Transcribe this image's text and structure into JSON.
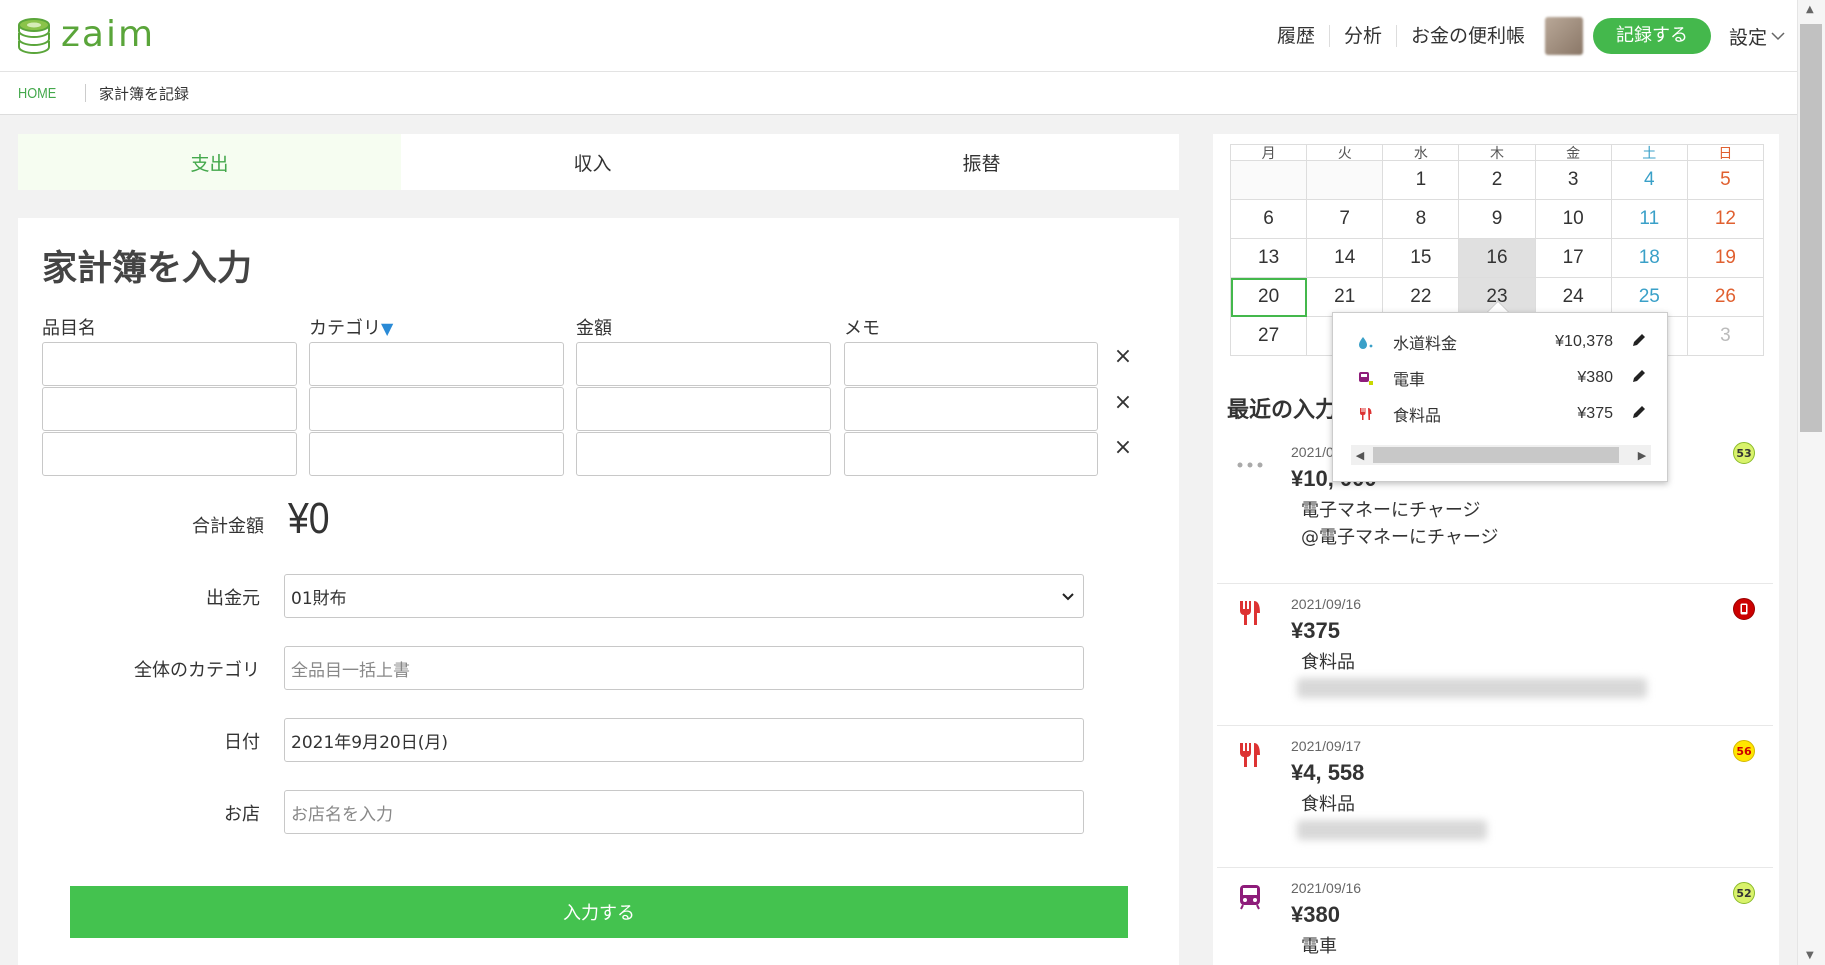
{
  "header": {
    "logo_text": "zaim",
    "nav": [
      "履歴",
      "分析",
      "お金の便利帳"
    ],
    "record_button": "記録する",
    "settings": "設定"
  },
  "breadcrumb": {
    "home": "HOME",
    "current": "家計簿を記録"
  },
  "tabs": [
    "支出",
    "収入",
    "振替"
  ],
  "form": {
    "title": "家計簿を入力",
    "columns": {
      "item": "品目名",
      "category": "カテゴリ",
      "category_marker": "▼",
      "amount": "金額",
      "memo": "メモ"
    },
    "remove_glyph": "×",
    "total_label": "合計金額",
    "total_value": "¥0",
    "source_label": "出金元",
    "source_value": "01財布",
    "overall_category_label": "全体のカテゴリ",
    "overall_category_placeholder": "全品目一括上書",
    "date_label": "日付",
    "date_value": "2021年9月20日(月)",
    "shop_label": "お店",
    "shop_placeholder": "お店名を入力",
    "submit": "入力する"
  },
  "calendar": {
    "weekdays": [
      "月",
      "火",
      "水",
      "木",
      "金",
      "土",
      "日"
    ],
    "weeks": [
      [
        "",
        "",
        "1",
        "2",
        "3",
        "4",
        "5"
      ],
      [
        "6",
        "7",
        "8",
        "9",
        "10",
        "11",
        "12"
      ],
      [
        "13",
        "14",
        "15",
        "16",
        "17",
        "18",
        "19"
      ],
      [
        "20",
        "21",
        "22",
        "23",
        "24",
        "25",
        "26"
      ],
      [
        "27",
        "",
        "",
        "",
        "",
        "",
        "3"
      ]
    ]
  },
  "popup": {
    "items": [
      {
        "name": "水道料金",
        "amount": "¥10,378",
        "icon": "water-icon"
      },
      {
        "name": "電車",
        "amount": "¥380",
        "icon": "train-icon"
      },
      {
        "name": "食料品",
        "amount": "¥375",
        "icon": "fork-knife-icon"
      }
    ],
    "edit_icon": "pencil-icon"
  },
  "recent": {
    "title": "最近の入力",
    "entries": [
      {
        "date": "2021/09",
        "amount": "¥10, 000",
        "category": "電子マネーにチャージ",
        "memo": "@電子マネーにチャージ",
        "badge": "53",
        "icon": "dots-icon"
      },
      {
        "date": "2021/09/16",
        "amount": "¥375",
        "category": "食料品",
        "badge": "",
        "icon": "fork-knife-icon"
      },
      {
        "date": "2021/09/17",
        "amount": "¥4, 558",
        "category": "食料品",
        "badge": "56",
        "icon": "fork-knife-icon"
      },
      {
        "date": "2021/09/16",
        "amount": "¥380",
        "category": "電車",
        "badge": "52",
        "icon": "train-icon"
      }
    ]
  },
  "colors": {
    "accent": "#44b84c",
    "saturday": "#3aa0c8",
    "sunday": "#e06030"
  }
}
